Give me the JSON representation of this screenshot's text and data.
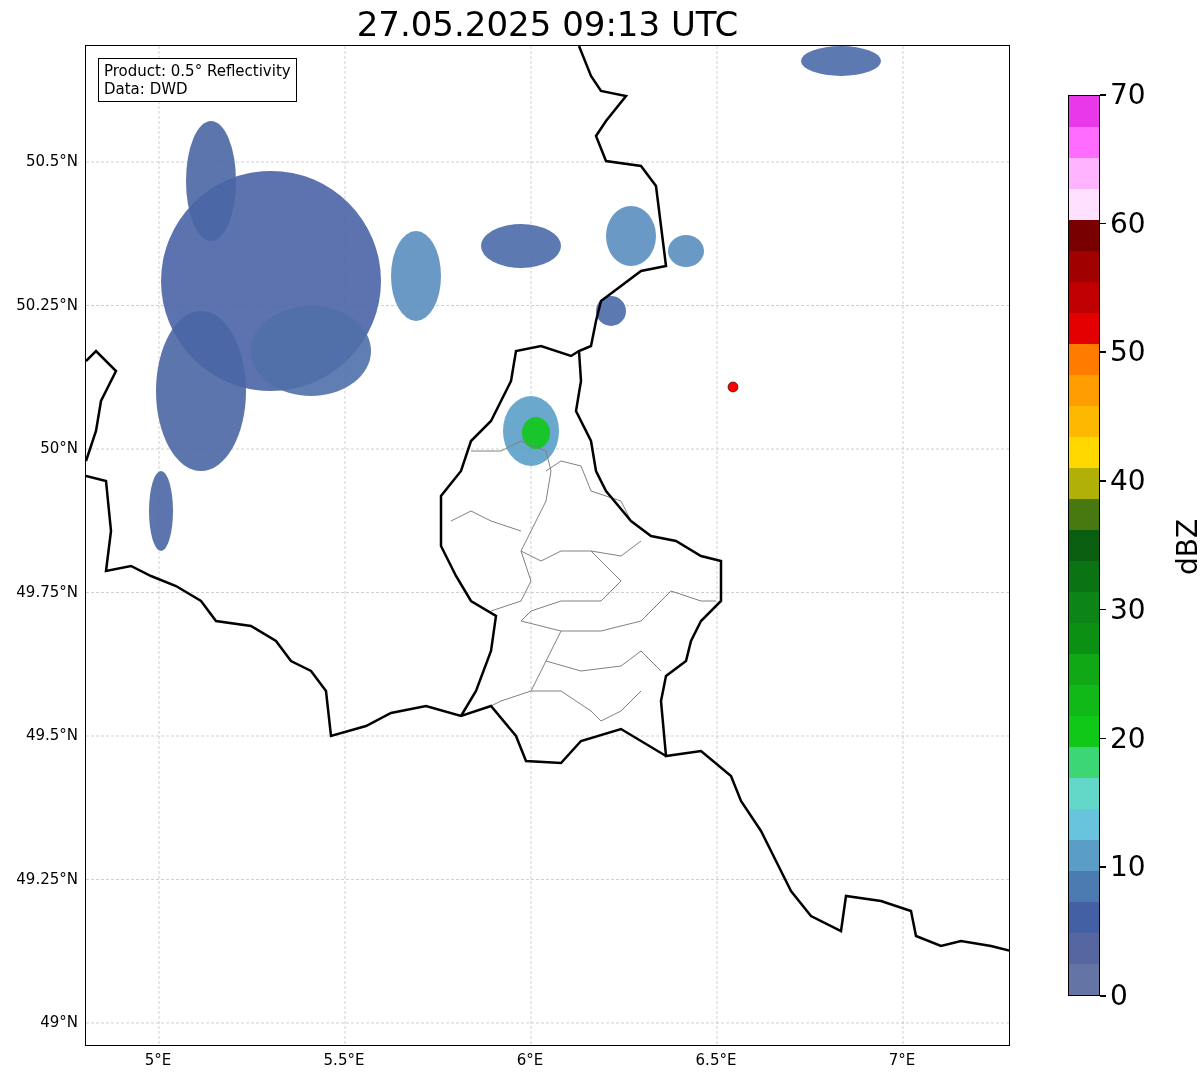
{
  "title": "27.05.2025 09:13 UTC",
  "info_box": {
    "lines": [
      "Product: 0.5° Reflectivity",
      "Data: DWD"
    ]
  },
  "map": {
    "y_ticks": [
      "50.5°N",
      "50.25°N",
      "50°N",
      "49.75°N",
      "49.5°N",
      "49.25°N",
      "49°N"
    ],
    "x_ticks": [
      "5°E",
      "5.5°E",
      "6°E",
      "6.5°E",
      "7°E"
    ]
  },
  "colorbar": {
    "label": "dBZ",
    "ticks": [
      "70",
      "60",
      "50",
      "40",
      "30",
      "20",
      "10",
      "0"
    ],
    "bins": [
      {
        "color": "#6474a4"
      },
      {
        "color": "#5566a0"
      },
      {
        "color": "#4460a4"
      },
      {
        "color": "#4a7ab0"
      },
      {
        "color": "#5a9ec8"
      },
      {
        "color": "#68c4dc"
      },
      {
        "color": "#64d8c8"
      },
      {
        "color": "#3cd674"
      },
      {
        "color": "#10c818"
      },
      {
        "color": "#10b818"
      },
      {
        "color": "#10a814"
      },
      {
        "color": "#0c9014"
      },
      {
        "color": "#0c8418"
      },
      {
        "color": "#0a7414"
      },
      {
        "color": "#0a5e10"
      },
      {
        "color": "#487810"
      },
      {
        "color": "#b0b008"
      },
      {
        "color": "#ffd800"
      },
      {
        "color": "#ffb800"
      },
      {
        "color": "#ff9c00"
      },
      {
        "color": "#ff7c00"
      },
      {
        "color": "#e40000"
      },
      {
        "color": "#c00000"
      },
      {
        "color": "#a00000"
      },
      {
        "color": "#780000"
      },
      {
        "color": "#ffe0ff"
      },
      {
        "color": "#ffb4ff"
      },
      {
        "color": "#ff6cff"
      },
      {
        "color": "#e838e8"
      }
    ]
  }
}
